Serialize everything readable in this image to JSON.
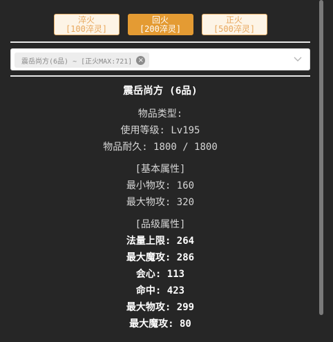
{
  "tabs": [
    {
      "name": "淬火",
      "cost": "[100淬灵]"
    },
    {
      "name": "回火",
      "cost": "[200淬灵]"
    },
    {
      "name": "正火",
      "cost": "[500淬灵]"
    }
  ],
  "select": {
    "tag_label": "震岳尚方(6品) ~ [正火MAX:721]"
  },
  "item": {
    "title": "震岳尚方 (6品)",
    "type_label": "物品类型:",
    "level_label": "使用等级: Lv195",
    "durability_label": "物品耐久: 1800 / 1800"
  },
  "basic": {
    "header": "[基本属性]",
    "stats": [
      "最小物攻: 160",
      "最大物攻: 320"
    ]
  },
  "grade": {
    "header": "[品级属性]",
    "stats": [
      "法量上限: 264",
      "最大魔攻: 286",
      "会心: 113",
      "命中: 423",
      "最大物攻: 299",
      "最大魔攻: 80"
    ]
  }
}
